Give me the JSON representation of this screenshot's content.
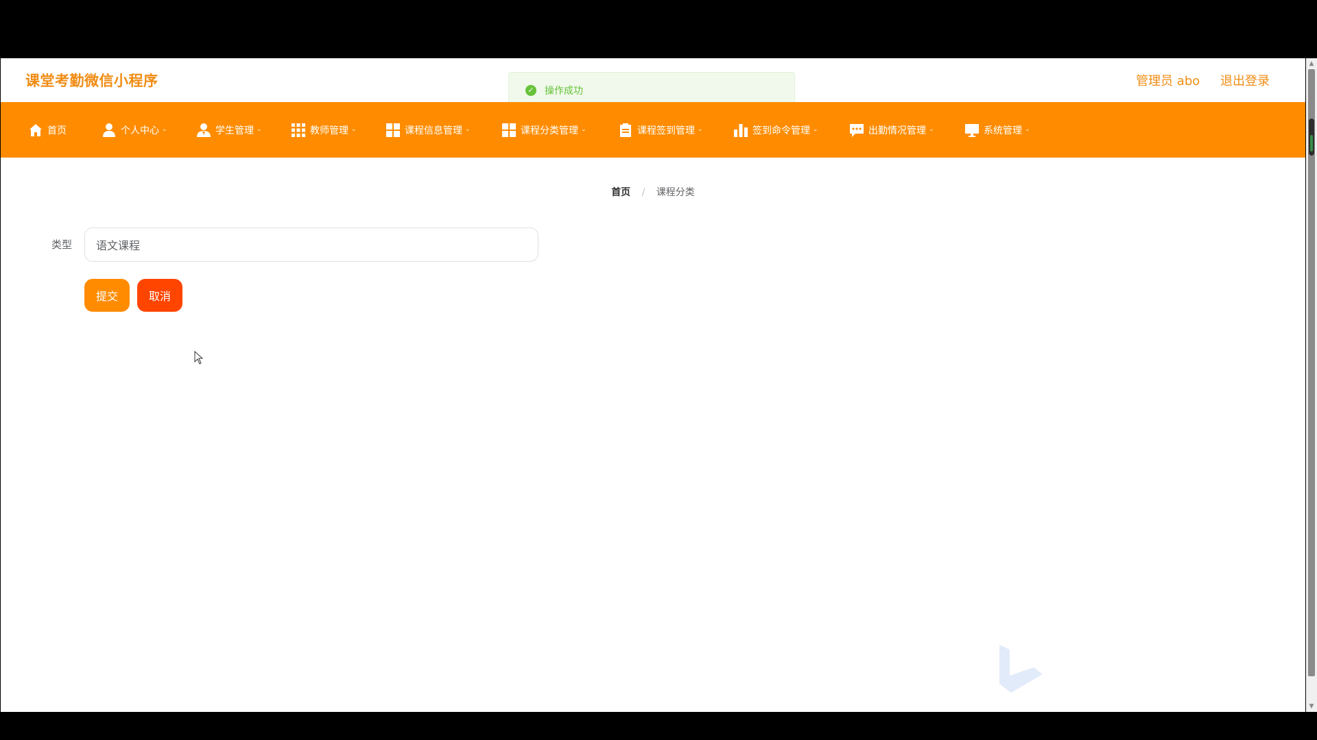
{
  "header": {
    "site_title": "课堂考勤微信小程序",
    "admin_label": "管理员 abo",
    "logout_label": "退出登录"
  },
  "toast": {
    "message": "操作成功",
    "icon": "check-circle-icon"
  },
  "nav": {
    "items": [
      {
        "label": "首页",
        "icon": "home-icon"
      },
      {
        "label": "个人中心",
        "icon": "user-icon"
      },
      {
        "label": "学生管理",
        "icon": "student-icon"
      },
      {
        "label": "教师管理",
        "icon": "grid-icon"
      },
      {
        "label": "课程信息管理",
        "icon": "dashboard-icon"
      },
      {
        "label": "课程分类管理",
        "icon": "dashboard-icon"
      },
      {
        "label": "课程签到管理",
        "icon": "clipboard-icon"
      },
      {
        "label": "签到命令管理",
        "icon": "bar-chart-icon"
      },
      {
        "label": "出勤情况管理",
        "icon": "chat-icon"
      },
      {
        "label": "系统管理",
        "icon": "monitor-icon"
      }
    ]
  },
  "breadcrumb": {
    "home": "首页",
    "separator": "/",
    "current": "课程分类"
  },
  "form": {
    "type_label": "类型",
    "type_value": "语文课程",
    "submit_label": "提交",
    "cancel_label": "取消"
  },
  "colors": {
    "accent": "#ff8c00",
    "title": "#f08c14",
    "cancel": "#ff4500",
    "success": "#67c23a"
  }
}
